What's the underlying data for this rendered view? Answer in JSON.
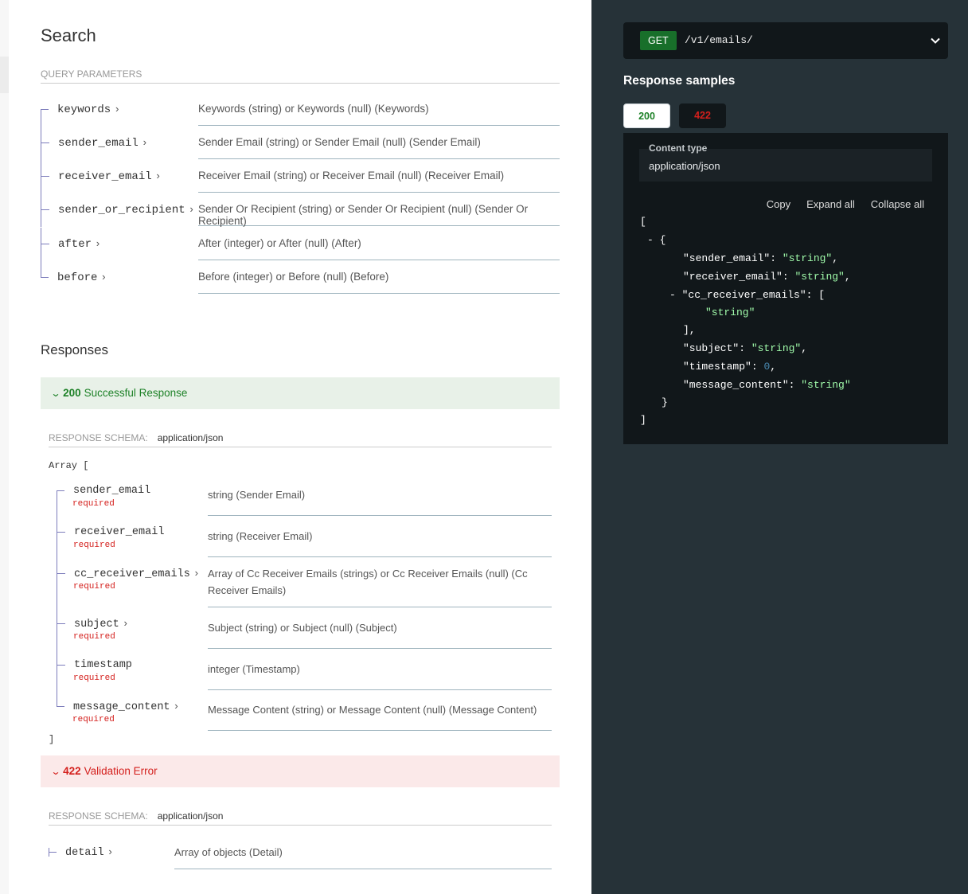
{
  "search": {
    "title": "Search",
    "query_caption": "QUERY PARAMETERS",
    "params": [
      {
        "name": "keywords",
        "desc": "Keywords (string) or Keywords (null) (Keywords)"
      },
      {
        "name": "sender_email",
        "desc": "Sender Email (string) or Sender Email (null) (Sender Email)"
      },
      {
        "name": "receiver_email",
        "desc": "Receiver Email (string) or Receiver Email (null) (Receiver Email)"
      },
      {
        "name": "sender_or_recipient",
        "desc": "Sender Or Recipient (string) or Sender Or Recipient (null) (Sender Or Recipient)"
      },
      {
        "name": "after",
        "desc": "After (integer) or After (null) (After)"
      },
      {
        "name": "before",
        "desc": "Before (integer) or Before (null) (Before)"
      }
    ]
  },
  "responses": {
    "title": "Responses",
    "ok": {
      "code": "200",
      "label": "Successful Response",
      "schema_caption": "RESPONSE SCHEMA:",
      "mime": "application/json",
      "open_bracket": "Array [",
      "close_bracket": "]",
      "required_label": "required",
      "fields": [
        {
          "name": "sender_email",
          "desc": "string (Sender Email)"
        },
        {
          "name": "receiver_email",
          "desc": "string (Receiver Email)"
        },
        {
          "name": "cc_receiver_emails",
          "desc": "Array of Cc Receiver Emails (strings) or Cc Receiver Emails (null) (Cc Receiver Emails)"
        },
        {
          "name": "subject",
          "desc": "Subject (string) or Subject (null) (Subject)"
        },
        {
          "name": "timestamp",
          "desc": "integer (Timestamp)"
        },
        {
          "name": "message_content",
          "desc": "Message Content (string) or Message Content (null) (Message Content)"
        }
      ]
    },
    "err": {
      "code": "422",
      "label": "Validation Error",
      "schema_caption": "RESPONSE SCHEMA:",
      "mime": "application/json",
      "field": {
        "name": "detail",
        "desc": "Array of objects (Detail)"
      }
    }
  },
  "panel": {
    "method": "GET",
    "path": "/v1/emails/",
    "samples_title": "Response samples",
    "tabs": [
      "200",
      "422"
    ],
    "content_type_label": "Content type",
    "content_type": "application/json",
    "copy": "Copy",
    "expand_all": "Expand all",
    "collapse_all": "Collapse all",
    "code": {
      "open": "[",
      "obj_open": "{",
      "k_sender": "\"sender_email\"",
      "k_receiver": "\"receiver_email\"",
      "k_cc": "\"cc_receiver_emails\"",
      "k_subject": "\"subject\"",
      "k_timestamp": "\"timestamp\"",
      "k_message": "\"message_content\"",
      "v_string": "\"string\"",
      "v_zero": "0",
      "toggle": "-",
      "arr_close": "],",
      "obj_close": "}",
      "close": "]"
    }
  },
  "colors": {
    "get_badge": "#186f2a",
    "success": "#1d8127",
    "error": "#d41f1c",
    "panel_bg": "#263238",
    "code_string": "#a0fbaa"
  }
}
